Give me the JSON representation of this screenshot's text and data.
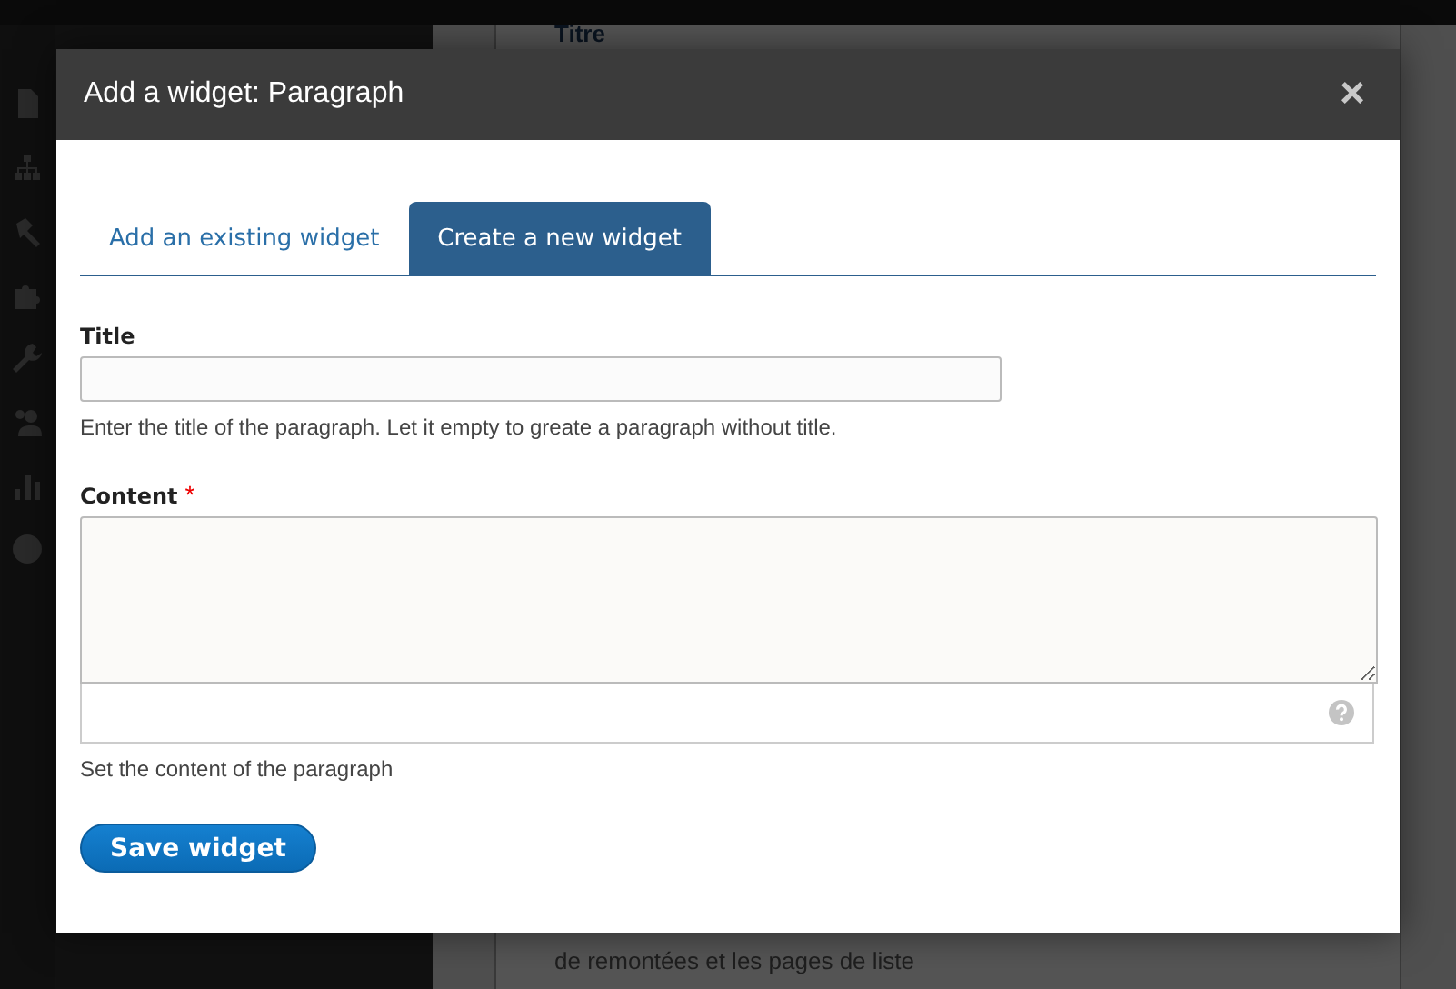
{
  "background": {
    "top_text": "Titre",
    "bottom_text": "de remontées et les pages de liste"
  },
  "dialog": {
    "title": "Add a widget: Paragraph",
    "close": "×",
    "tabs": [
      {
        "label": "Add an existing widget",
        "selected": false
      },
      {
        "label": "Create a new widget",
        "selected": true
      }
    ],
    "fields": [
      {
        "kind": "input",
        "label": "Title",
        "description": "Enter the title of the paragraph. Let it empty to greate a paragraph without title."
      },
      {
        "kind": "textarea",
        "label": "Content",
        "required_mark": "*",
        "description": "Set the content of the paragraph"
      }
    ],
    "button": "Save widget"
  }
}
